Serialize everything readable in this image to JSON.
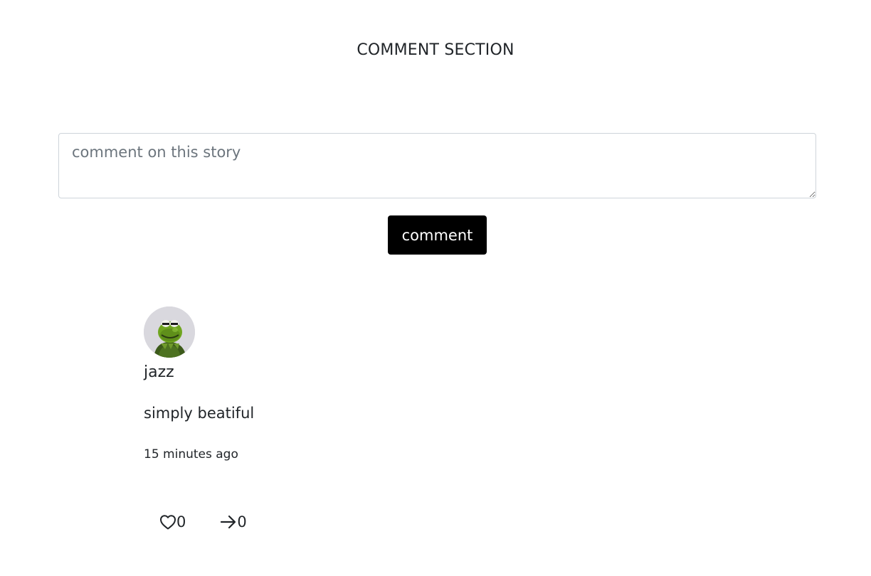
{
  "page": {
    "title": "COMMENT SECTION"
  },
  "composer": {
    "placeholder": "comment on this story",
    "value": "",
    "submit_label": "comment"
  },
  "comments": [
    {
      "author": "jazz",
      "avatar": "kermit-frog-avatar",
      "text": "simply beatiful",
      "time": "15 minutes ago",
      "likes": "0",
      "shares": "0"
    }
  ],
  "icons": {
    "like": "heart-outline-icon",
    "share": "arrow-right-icon"
  },
  "colors": {
    "button_bg": "#000000",
    "button_text": "#ffffff",
    "text": "#212529",
    "placeholder": "#6c757d",
    "border": "#ced4da"
  }
}
